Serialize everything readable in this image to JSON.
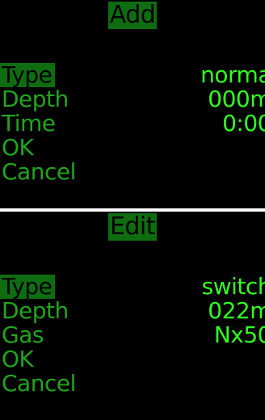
{
  "add_panel": {
    "title": "Add",
    "items": [
      {
        "label": "Type"
      },
      {
        "label": "Depth"
      },
      {
        "label": "Time"
      },
      {
        "label": "OK"
      },
      {
        "label": "Cancel"
      }
    ],
    "values": [
      "norma",
      "000m",
      "0:00"
    ]
  },
  "edit_panel": {
    "title": "Edit",
    "items": [
      {
        "label": "Type"
      },
      {
        "label": "Depth"
      },
      {
        "label": "Gas"
      },
      {
        "label": "OK"
      },
      {
        "label": "Cancel"
      }
    ],
    "values": [
      "switch",
      "022m",
      "Nx50"
    ]
  },
  "colors": {
    "background": "#000000",
    "highlight": "#0f6d11",
    "label_text": "#22a51c",
    "value_text": "#33ff22",
    "separator": "#ffffff"
  }
}
